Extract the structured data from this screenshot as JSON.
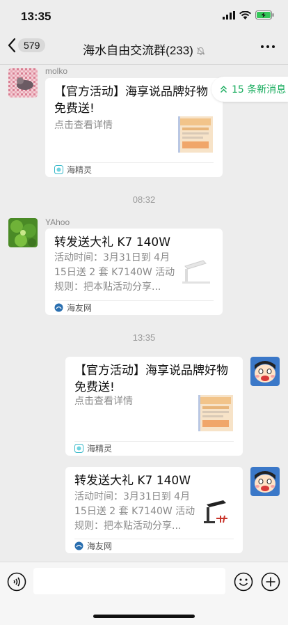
{
  "status": {
    "time": "13:35"
  },
  "nav": {
    "back_count": "579",
    "title": "海水自由交流群(233)"
  },
  "new_messages": {
    "label": "15 条新消息"
  },
  "messages": [
    {
      "sender": "molko",
      "title_line1": "【官方活动】海享说品牌好物",
      "title_line2": "免费送!",
      "desc_line1": "点击查看详情",
      "desc_line2": "",
      "desc_line3": "",
      "source": "海精灵"
    },
    {
      "sender": "YAhoo",
      "title_line1": "转发送大礼 K7 140W",
      "title_line2": "",
      "desc_line1": "活动时间：3月31日到 4月",
      "desc_line2": "15日送 2 套 K7140W 活动",
      "desc_line3": "规则：把本贴活动分享...",
      "source": "海友网"
    },
    {
      "sender": "",
      "title_line1": "【官方活动】海享说品牌好物",
      "title_line2": "免费送!",
      "desc_line1": "点击查看详情",
      "desc_line2": "",
      "desc_line3": "",
      "source": "海精灵"
    },
    {
      "sender": "",
      "title_line1": "转发送大礼 K7 140W",
      "title_line2": "",
      "desc_line1": "活动时间：3月31日到 4月",
      "desc_line2": "15日送 2 套 K7140W 活动",
      "desc_line3": "规则：把本贴活动分享...",
      "source": "海友网"
    }
  ],
  "timestamps": [
    "08:32",
    "13:35"
  ],
  "colors": {
    "accent_green": "#1aad5f",
    "background": "#ededed",
    "card": "#ffffff"
  }
}
